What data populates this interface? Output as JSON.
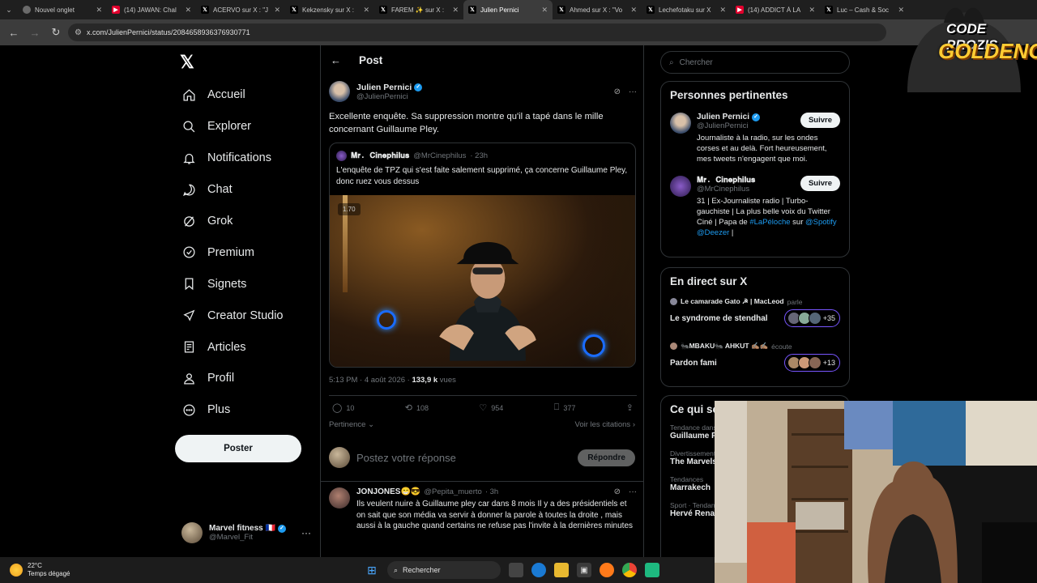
{
  "browser": {
    "tabs": [
      {
        "label": "Nouvel onglet",
        "icon": "globe-icon"
      },
      {
        "label": "(14) JAWAN: Chal",
        "icon": "youtube-icon"
      },
      {
        "label": "ACERVO sur X : \"J",
        "icon": "x-icon"
      },
      {
        "label": "Kekzensky sur X :",
        "icon": "x-icon"
      },
      {
        "label": "FAREM ✨ sur X :",
        "icon": "x-icon"
      },
      {
        "label": "Julien Pernici",
        "icon": "x-icon",
        "active": true
      },
      {
        "label": "Ahmed sur X : \"Vo",
        "icon": "x-icon"
      },
      {
        "label": "Lechefotaku sur X",
        "icon": "x-icon"
      },
      {
        "label": "(14) ADDICT À LA",
        "icon": "youtube-icon"
      },
      {
        "label": "Luc – Cash & Soc",
        "icon": "x-icon"
      }
    ],
    "url": "x.com/JulienPernici/status/2084658936376930771"
  },
  "sidebar": {
    "items": [
      {
        "label": "Accueil",
        "icon": "home-icon"
      },
      {
        "label": "Explorer",
        "icon": "search-icon"
      },
      {
        "label": "Notifications",
        "icon": "bell-icon"
      },
      {
        "label": "Chat",
        "icon": "chat-icon"
      },
      {
        "label": "Grok",
        "icon": "grok-icon"
      },
      {
        "label": "Premium",
        "icon": "verified-icon"
      },
      {
        "label": "Signets",
        "icon": "bookmark-icon"
      },
      {
        "label": "Creator Studio",
        "icon": "rocket-icon"
      },
      {
        "label": "Articles",
        "icon": "article-icon"
      },
      {
        "label": "Profil",
        "icon": "person-icon"
      },
      {
        "label": "Plus",
        "icon": "more-circle-icon"
      }
    ],
    "post_button": "Poster",
    "account": {
      "name": "Marvel fitness 🇫🇷",
      "handle": "@Marvel_Fit"
    }
  },
  "post": {
    "header": "Post",
    "author_name": "Julien Pernici",
    "author_handle": "@JulienPernici",
    "text": "Excellente enquête. Sa suppression montre qu'il a tapé dans le mille concernant Guillaume Pley.",
    "quote": {
      "name": "𝐌𝐫. 𝐂𝐢𝐧𝐞𝐩𝐡𝐢𝐥𝐮𝐬",
      "handle": "@MrCinephilus",
      "time": "· 23h",
      "text": "L'enquête de TPZ qui s'est faite salement supprimé, ça concerne Guillaume Pley, donc ruez vous dessus",
      "video_speed": "1.70"
    },
    "time": "5:13 PM · 4 août 2026 ·",
    "views_count": "133,9 k",
    "views_label": "vues",
    "actions": {
      "replies": "10",
      "reposts": "108",
      "likes": "954",
      "bookmarks": "377"
    },
    "sort_label": "Pertinence",
    "quotes_link": "Voir les citations",
    "reply_placeholder": "Postez votre réponse",
    "reply_button": "Répondre"
  },
  "reply": {
    "name": "JONJONES😁😎",
    "handle": "@Pepita_muerto",
    "time": "· 3h",
    "text": "Ils veulent nuire à Guillaume pley car dans 8 mois Il y a des présidentiels et on sait que son média va servir à donner la parole à toutes la droite , mais aussi à la gauche quand certains ne refuse pas l'invite à la dernières minutes"
  },
  "right": {
    "search_placeholder": "Chercher",
    "relevant_title": "Personnes pertinentes",
    "people": [
      {
        "name": "Julien Pernici",
        "handle": "@JulienPernici",
        "follow": "Suivre",
        "bio": "Journaliste à la radio, sur les ondes corses et au delà. Fort heureusement, mes tweets n'engagent que moi."
      },
      {
        "name": "𝐌𝐫. 𝐂𝐢𝐧𝐞𝐩𝐡𝐢𝐥𝐮𝐬",
        "handle": "@MrCinephilus",
        "follow": "Suivre",
        "bio_start": "31 | Ex-Journaliste radio | Turbo-gauchiste | La plus belle voix du Twitter Ciné | Papa de ",
        "bio_link1": "#LaPéloche",
        "bio_mid": " sur ",
        "bio_link2": "@Spotify @Deezer",
        "bio_end": " |"
      }
    ],
    "live_title": "En direct sur X",
    "live": [
      {
        "host": "Le camarade Gato ☭ | MacLeod",
        "verb": "parle",
        "title": "Le syndrome de stendhal",
        "count": "+35"
      },
      {
        "host": "🐜MBAKU🐜 AHKUT ✍🏽✍🏽",
        "verb": "écoute",
        "title": "Pardon fami",
        "count": "+13"
      }
    ],
    "trends_title": "Ce qui se passe",
    "trends": [
      {
        "category": "Tendance dans",
        "name": "Guillaume P"
      },
      {
        "category": "Divertissement",
        "name": "The Marvels"
      },
      {
        "category": "Tendances",
        "name": "Marrakech"
      },
      {
        "category": "Sport · Tendance",
        "name": "Hervé Rena"
      }
    ]
  },
  "overlay": {
    "logo_line1": "CODE PROZIS",
    "logo_line2": "GOLDENG"
  },
  "taskbar": {
    "temp": "22°C",
    "weather": "Temps dégagé",
    "search": "Rechercher"
  }
}
